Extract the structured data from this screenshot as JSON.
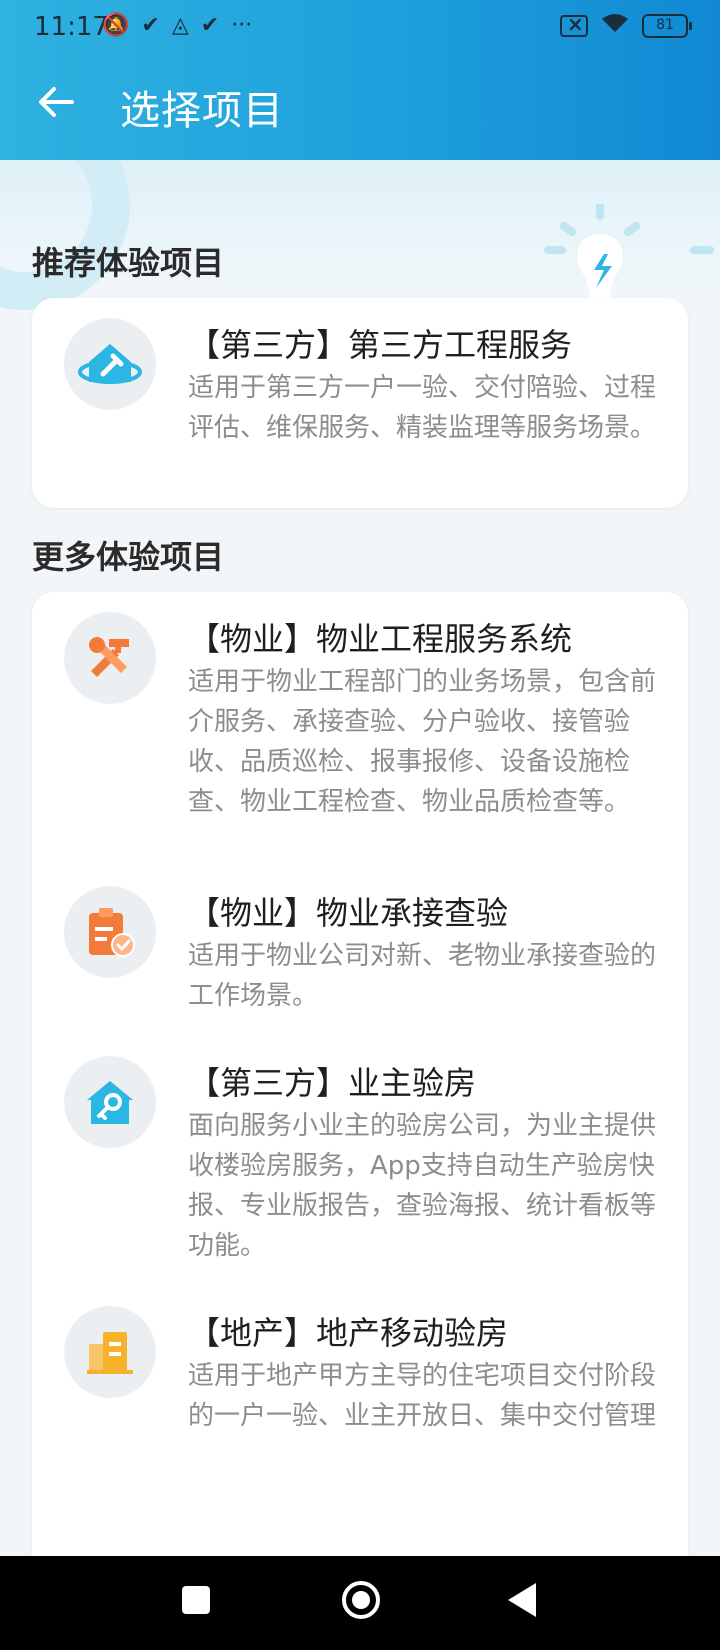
{
  "status_bar": {
    "time": "11:17",
    "left_icons": [
      "muted-bell-icon",
      "check-icon",
      "triangle-app-icon",
      "check-icon",
      "more-dots-icon"
    ],
    "battery": "81"
  },
  "header": {
    "title": "选择项目"
  },
  "recommended": {
    "section_title": "推荐体验项目",
    "items": [
      {
        "title": "【第三方】第三方工程服务",
        "desc": "适用于第三方一户一验、交付陪验、过程评估、维保服务、精装监理等服务场景。",
        "icon": "house-hammer-icon"
      }
    ]
  },
  "more": {
    "section_title": "更多体验项目",
    "items": [
      {
        "title": "【物业】物业工程服务系统",
        "desc": "适用于物业工程部门的业务场景，包含前介服务、承接查验、分户验收、接管验收、品质巡检、报事报修、设备设施检查、物业工程检查、物业品质检查等。",
        "icon": "tools-icon"
      },
      {
        "title": "【物业】物业承接查验",
        "desc": "适用于物业公司对新、老物业承接查验的工作场景。",
        "icon": "clipboard-check-icon"
      },
      {
        "title": "【第三方】业主验房",
        "desc": "面向服务小业主的验房公司，为业主提供收楼验房服务，App支持自动生产验房快报、专业版报告，查验海报、统计看板等功能。",
        "icon": "house-key-icon"
      },
      {
        "title": "【地产】地产移动验房",
        "desc": "适用于地产甲方主导的住宅项目交付阶段的一户一验、业主开放日、集中交付管理",
        "icon": "building-icon"
      }
    ]
  },
  "colors": {
    "header_start": "#2fb2e0",
    "header_end": "#1189d4",
    "orange_icon": "#f47a3a",
    "blue_icon": "#2bb6e3",
    "yellow_icon": "#f7b12b"
  }
}
